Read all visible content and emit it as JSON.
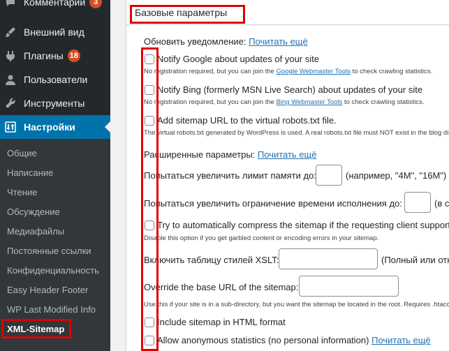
{
  "sidebar": {
    "top_items": [
      {
        "label": "Комментарии",
        "badge": "3",
        "icon": "comment-icon"
      },
      {
        "label": "Внешний вид",
        "icon": "paintbrush-icon"
      },
      {
        "label": "Плагины",
        "badge": "18",
        "icon": "plugin-icon"
      },
      {
        "label": "Пользователи",
        "icon": "users-icon"
      },
      {
        "label": "Инструменты",
        "icon": "wrench-icon"
      },
      {
        "label": "Настройки",
        "icon": "settings-icon",
        "active": true
      }
    ],
    "sub_items": [
      "Общие",
      "Написание",
      "Чтение",
      "Обсуждение",
      "Медиафайлы",
      "Постоянные ссылки",
      "Конфиденциальность",
      "Easy Header Footer",
      "WP Last Modified Info",
      "XML-Sitemap"
    ]
  },
  "panel": {
    "title": "Базовые параметры",
    "notify_heading": "Обновить уведомление:",
    "notify_link": "Почитать ещё",
    "google": {
      "label": "Notify Google about updates of your site",
      "note_prefix": "No registration required, but you can join the ",
      "note_link": "Google Webmaster Tools",
      "note_suffix": " to check crawling statistics."
    },
    "bing": {
      "label": "Notify Bing (formerly MSN Live Search) about updates of your site",
      "note_prefix": "No registration required, but you can join the ",
      "note_link": "Bing Webmaster Tools",
      "note_suffix": " to check crawling statistics."
    },
    "robots": {
      "label": "Add sitemap URL to the virtual robots.txt file.",
      "note": "The virtual robots.txt generated by WordPress is used. A real robots.txt file must NOT exist in the blog directory!"
    },
    "advanced_heading": "Расширенные параметры:",
    "advanced_link": "Почитать ещё",
    "memory_label": "Попытаться увеличить лимит памяти до:",
    "memory_hint": "(например, \"4M\", \"16M\")",
    "time_label": "Попытаться увеличить ограничение времени исполнения до:",
    "time_hint": "(в секундах)",
    "compress": {
      "label": "Try to automatically compress the sitemap if the requesting client supports it.",
      "note": "Disable this option if you get garbled content or encoding errors in your sitemap."
    },
    "xslt_label": "Включить таблицу стилей XSLT:",
    "xslt_hint": "(Полный или относительный URL)",
    "baseurl_label": "Override the base URL of the sitemap:",
    "baseurl_note": "Use this if your site is in a sub-directory, but you want the sitemap be located in the root. Requires .htaccess modification.",
    "html_label": "Include sitemap in HTML format",
    "stats_label": "Allow anonymous statistics (no personal information)",
    "stats_link": "Почитать ещё"
  },
  "colors": {
    "sidebar_bg": "#23282d",
    "active_bg": "#0073aa",
    "badge_bg": "#d54e21",
    "link": "#2271b1",
    "highlight_box": "#e00000"
  }
}
